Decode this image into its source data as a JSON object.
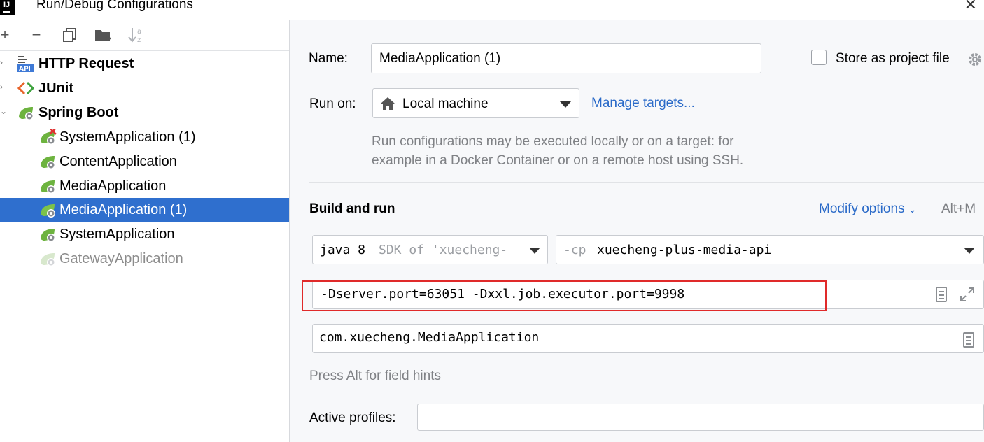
{
  "window": {
    "title": "Run/Debug Configurations",
    "logo_text": "IJ"
  },
  "tree": {
    "groups": [
      {
        "label": "HTTP Request",
        "icon": "api-icon"
      },
      {
        "label": "JUnit",
        "icon": "junit-icon"
      },
      {
        "label": "Spring Boot",
        "icon": "spring-boot-icon"
      }
    ],
    "items": [
      {
        "label": "SystemApplication (1)",
        "state": "error"
      },
      {
        "label": "ContentApplication",
        "state": "normal"
      },
      {
        "label": "MediaApplication",
        "state": "normal"
      },
      {
        "label": "MediaApplication (1)",
        "state": "selected"
      },
      {
        "label": "SystemApplication",
        "state": "normal"
      },
      {
        "label": "GatewayApplication",
        "state": "disabled"
      }
    ]
  },
  "form": {
    "name_label": "Name:",
    "name_value": "MediaApplication (1)",
    "store_label": "Store as project file",
    "run_on_label": "Run on:",
    "run_on_value": "Local machine",
    "manage_targets": "Manage targets...",
    "run_on_hint_1": "Run configurations may be executed locally or on a target: for",
    "run_on_hint_2": "example in a Docker Container or on a remote host using SSH.",
    "build_and_run": "Build and run",
    "modify_options": "Modify options",
    "modify_shortcut": "Alt+M",
    "sdk_main": "java 8",
    "sdk_hint": "SDK of 'xuecheng-",
    "cp_flag": "-cp",
    "cp_value": "xuecheng-plus-media-api",
    "vm_options": "-Dserver.port=63051 -Dxxl.job.executor.port=9998",
    "main_class": "com.xuecheng.MediaApplication",
    "field_hints": "Press Alt for field hints",
    "active_profiles_label": "Active profiles:",
    "active_profiles_value": ""
  },
  "colors": {
    "selection": "#2f6fce",
    "link": "#2a6ac8",
    "highlight": "#e02a2a"
  }
}
